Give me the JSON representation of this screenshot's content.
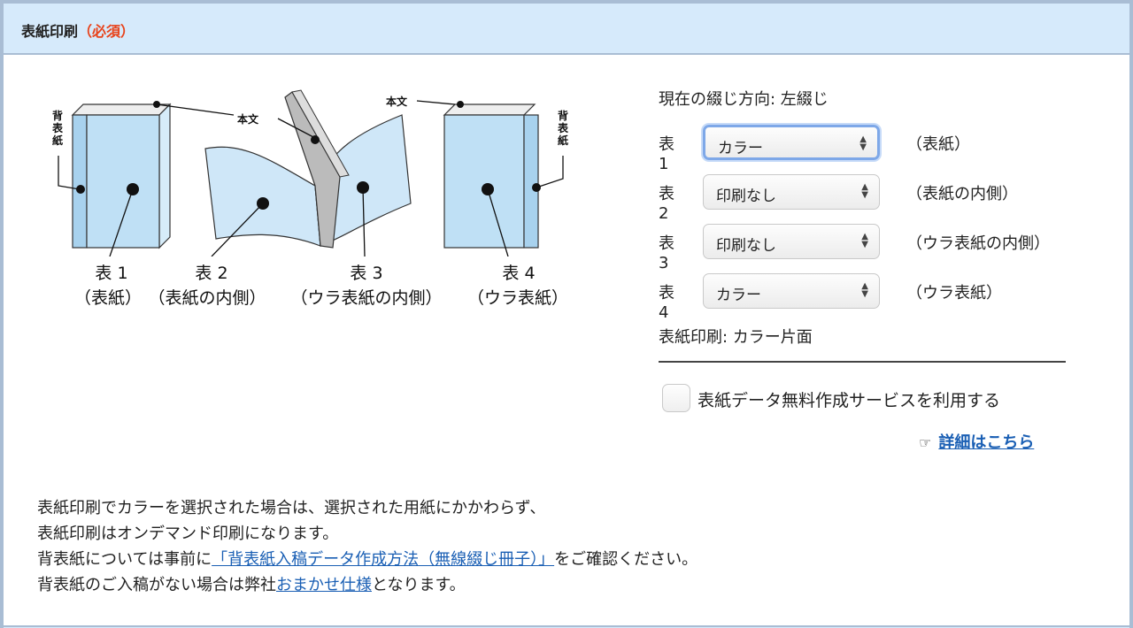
{
  "header": {
    "title": "表紙印刷",
    "required": "（必須）"
  },
  "illustration": {
    "honbun_label": "本文",
    "spine_label": [
      "背",
      "表",
      "紙"
    ],
    "covers": [
      {
        "num": "表 1",
        "desc": "（表紙）"
      },
      {
        "num": "表 2",
        "desc": "（表紙の内側）"
      },
      {
        "num": "表 3",
        "desc": "（ウラ表紙の内側）"
      },
      {
        "num": "表 4",
        "desc": "（ウラ表紙）"
      }
    ]
  },
  "binding_direction": "現在の綴じ方向: 左綴じ",
  "rows": [
    {
      "label": "表1",
      "value": "カラー",
      "desc": "（表紙）"
    },
    {
      "label": "表2",
      "value": "印刷なし",
      "desc": "（表紙の内側）"
    },
    {
      "label": "表3",
      "value": "印刷なし",
      "desc": "（ウラ表紙の内側）"
    },
    {
      "label": "表4",
      "value": "カラー",
      "desc": "（ウラ表紙）"
    }
  ],
  "cover_summary": "表紙印刷: カラー片面",
  "checkbox_label": "表紙データ無料作成サービスを利用する",
  "detail_link": "詳細はこちら",
  "notes": {
    "line1": "表紙印刷でカラーを選択された場合は、選択された用紙にかかわらず、",
    "line2": "表紙印刷はオンデマンド印刷になります。",
    "line3_pre": "背表紙については事前に",
    "line3_link": "「背表紙入稿データ作成方法（無線綴じ冊子）」",
    "line3_post": "をご確認ください。",
    "line4_pre": "背表紙のご入稿がない場合は弊社",
    "line4_link": "おまかせ仕様",
    "line4_post": "となります。"
  },
  "colors": {
    "header_bg": "#d6eafb",
    "border": "#a9bdd4",
    "link": "#1a5fb4",
    "required": "#e8421a",
    "book_blue": "#bfe0f5"
  }
}
